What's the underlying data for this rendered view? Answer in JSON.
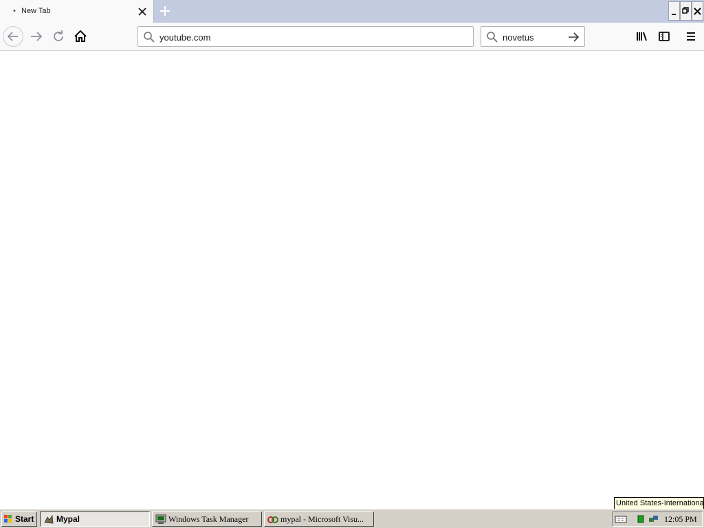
{
  "browser": {
    "tab": {
      "title": "New Tab",
      "loading_dot": "•"
    },
    "urlbar": {
      "value": "youtube.com"
    },
    "searchbar": {
      "value": "novetus"
    }
  },
  "tooltip": {
    "text": "United States-International"
  },
  "taskbar": {
    "start_label": "Start",
    "tasks": [
      {
        "label": "Mypal",
        "active": true
      },
      {
        "label": "Windows Task Manager",
        "active": false
      },
      {
        "label": "mypal - Microsoft Visu...",
        "active": false
      }
    ],
    "clock": "12:05 PM"
  },
  "colors": {
    "tabstrip_bg": "#c3cbe0",
    "toolbar_bg": "#f9f9fa",
    "taskbar_bg": "#d4d0c8",
    "tooltip_bg": "#ffffe1"
  },
  "icons": {
    "tab_close": "close-icon",
    "new_tab": "plus-icon",
    "back": "arrow-left-icon",
    "forward": "arrow-right-icon",
    "reload": "reload-icon",
    "home": "home-icon",
    "url_search": "search-icon",
    "search_go": "arrow-right-icon",
    "library": "library-icon",
    "sidebar": "sidebar-icon",
    "menu": "hamburger-menu-icon"
  }
}
